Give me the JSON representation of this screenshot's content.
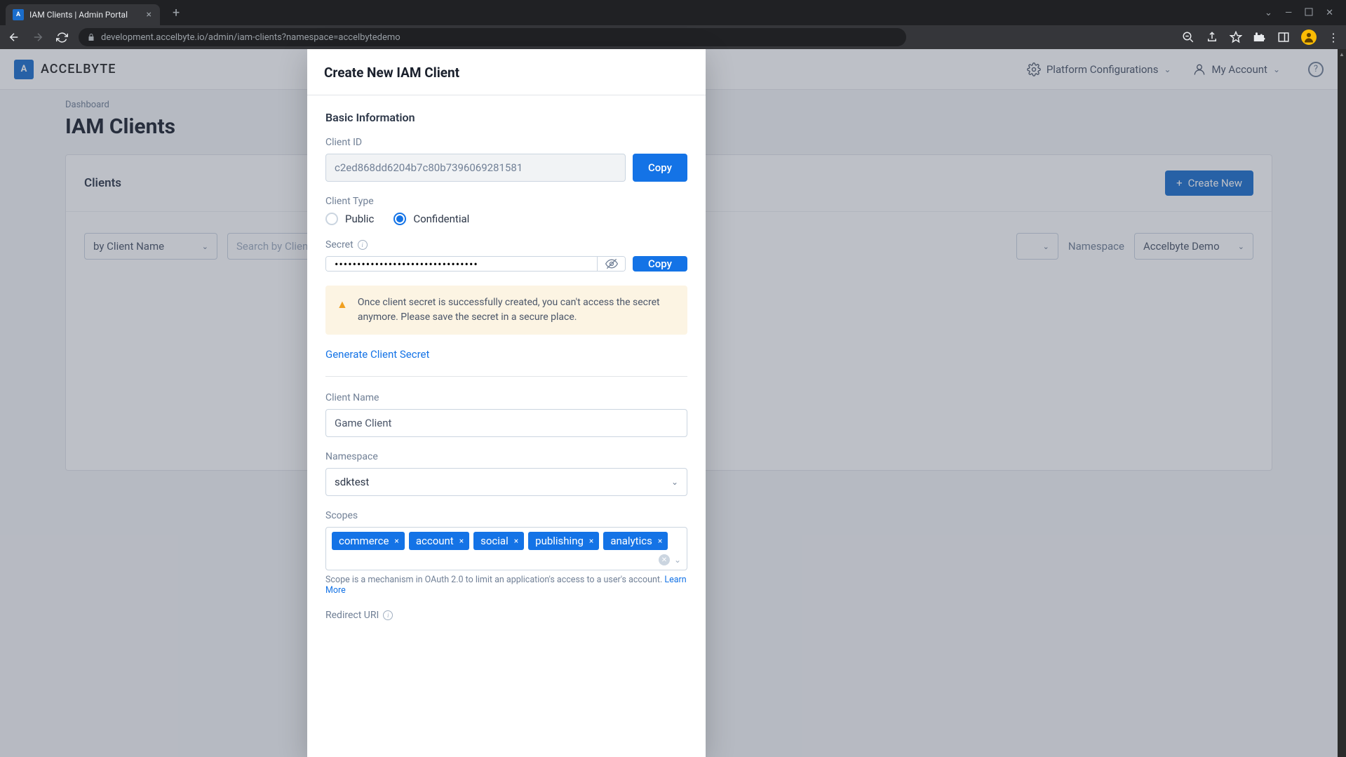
{
  "browser": {
    "tab_title": "IAM Clients | Admin Portal",
    "url": "development.accelbyte.io/admin/iam-clients?namespace=accelbytedemo"
  },
  "header": {
    "logo_text": "ACCELBYTE",
    "platform_config": "Platform Configurations",
    "my_account": "My Account"
  },
  "page": {
    "breadcrumb": "Dashboard",
    "title": "IAM Clients",
    "panel_title": "Clients",
    "create_btn": "Create New",
    "filter_by": "by Client Name",
    "search_placeholder": "Search by Client Name",
    "namespace_label": "Namespace",
    "namespace_value": "Accelbyte Demo"
  },
  "modal": {
    "title": "Create New IAM Client",
    "section_basic": "Basic Information",
    "client_id_label": "Client ID",
    "client_id_value": "c2ed868dd6204b7c80b7396069281581",
    "copy": "Copy",
    "client_type_label": "Client Type",
    "type_public": "Public",
    "type_confidential": "Confidential",
    "secret_label": "Secret",
    "secret_value": "••••••••••••••••••••••••••••••••",
    "warning": "Once client secret is successfully created, you can't access the secret anymore. Please save the secret in a secure place.",
    "generate_link": "Generate Client Secret",
    "client_name_label": "Client Name",
    "client_name_value": "Game Client",
    "namespace_label": "Namespace",
    "namespace_value": "sdktest",
    "scopes_label": "Scopes",
    "scopes": [
      "commerce",
      "account",
      "social",
      "publishing",
      "analytics"
    ],
    "scopes_help": "Scope is a mechanism in OAuth 2.0 to limit an application's access to a user's account. ",
    "learn_more": "Learn More",
    "redirect_label": "Redirect URI"
  }
}
